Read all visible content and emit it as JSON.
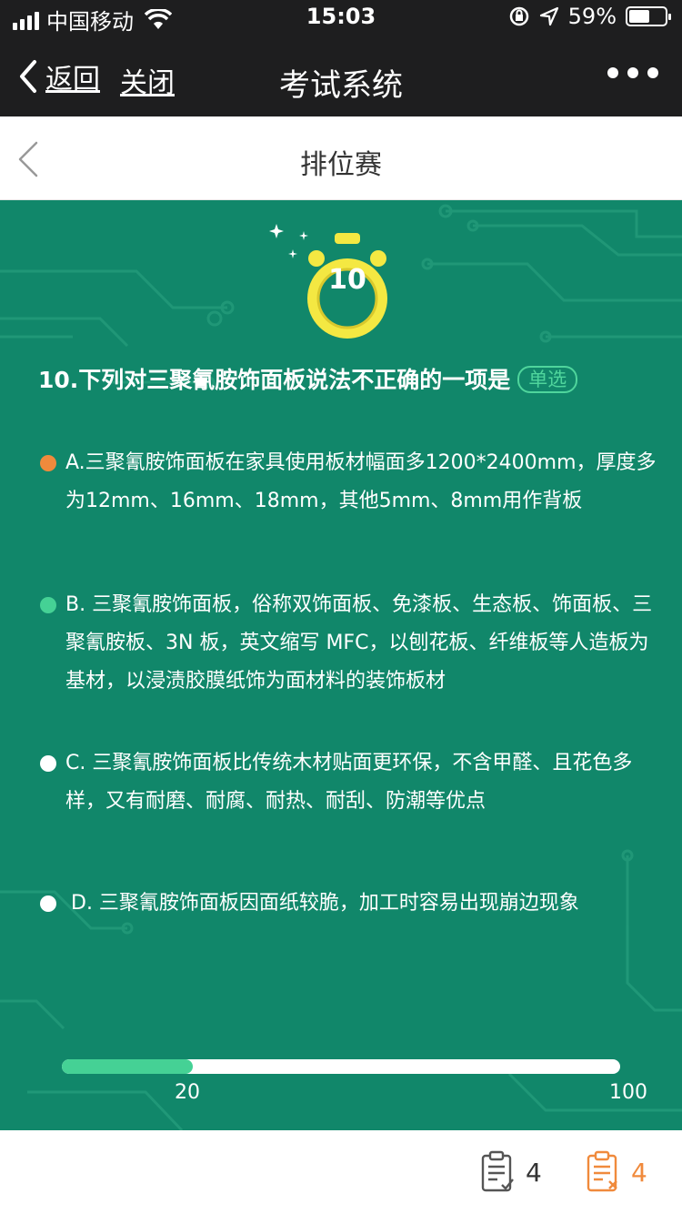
{
  "status_bar": {
    "carrier": "中国移动",
    "time": "15:03",
    "battery_percent": "59%",
    "battery_level": 0.59
  },
  "nav": {
    "back_label": "返回",
    "close_label": "关闭",
    "title": "考试系统"
  },
  "page": {
    "title": "排位赛"
  },
  "timer": {
    "value": "10"
  },
  "question": {
    "text": "10.下列对三聚氰胺饰面板说法不正确的一项是",
    "type_tag": "单选"
  },
  "options": [
    {
      "text": "A.三聚氰胺饰面板在家具使用板材幅面多1200*2400mm，厚度多为12mm、16mm、18mm，其他5mm、8mm用作背板",
      "dot_color": "#f08a3c"
    },
    {
      "text": "B. 三聚氰胺饰面板，俗称双饰面板、免漆板、生态板、饰面板、三聚氰胺板、3N 板，英文缩写 MFC，以刨花板、纤维板等人造板为基材，以浸渍胶膜纸饰为面材料的装饰板材",
      "dot_color": "#45d195"
    },
    {
      "text": "C. 三聚氰胺饰面板比传统木材贴面更环保，不含甲醛、且花色多样，又有耐磨、耐腐、耐热、耐刮、防潮等优点",
      "dot_color": "#ffffff"
    },
    {
      "text": "D. 三聚氰胺饰面板因面纸较脆，加工时容易出现崩边现象",
      "dot_color": "#ffffff"
    }
  ],
  "progress": {
    "current_label": "20",
    "max_label": "100",
    "current": 20,
    "max": 100
  },
  "footer": {
    "correct_count": "4",
    "wrong_count": "4"
  },
  "colors": {
    "background_green": "#11876a",
    "accent_green": "#45d195",
    "accent_orange": "#f08a3c",
    "timer_yellow": "#f4e842",
    "bar_dark": "#1e1e1f"
  },
  "icons": {
    "signal": "signal-icon",
    "wifi": "wifi-icon",
    "lock_rotation": "lock-rotation-icon",
    "location": "location-arrow-icon",
    "battery": "battery-icon",
    "back": "chevron-left-icon",
    "more": "more-dots-icon",
    "timer": "stopwatch-icon",
    "correct": "clipboard-check-icon",
    "wrong": "clipboard-x-icon"
  }
}
